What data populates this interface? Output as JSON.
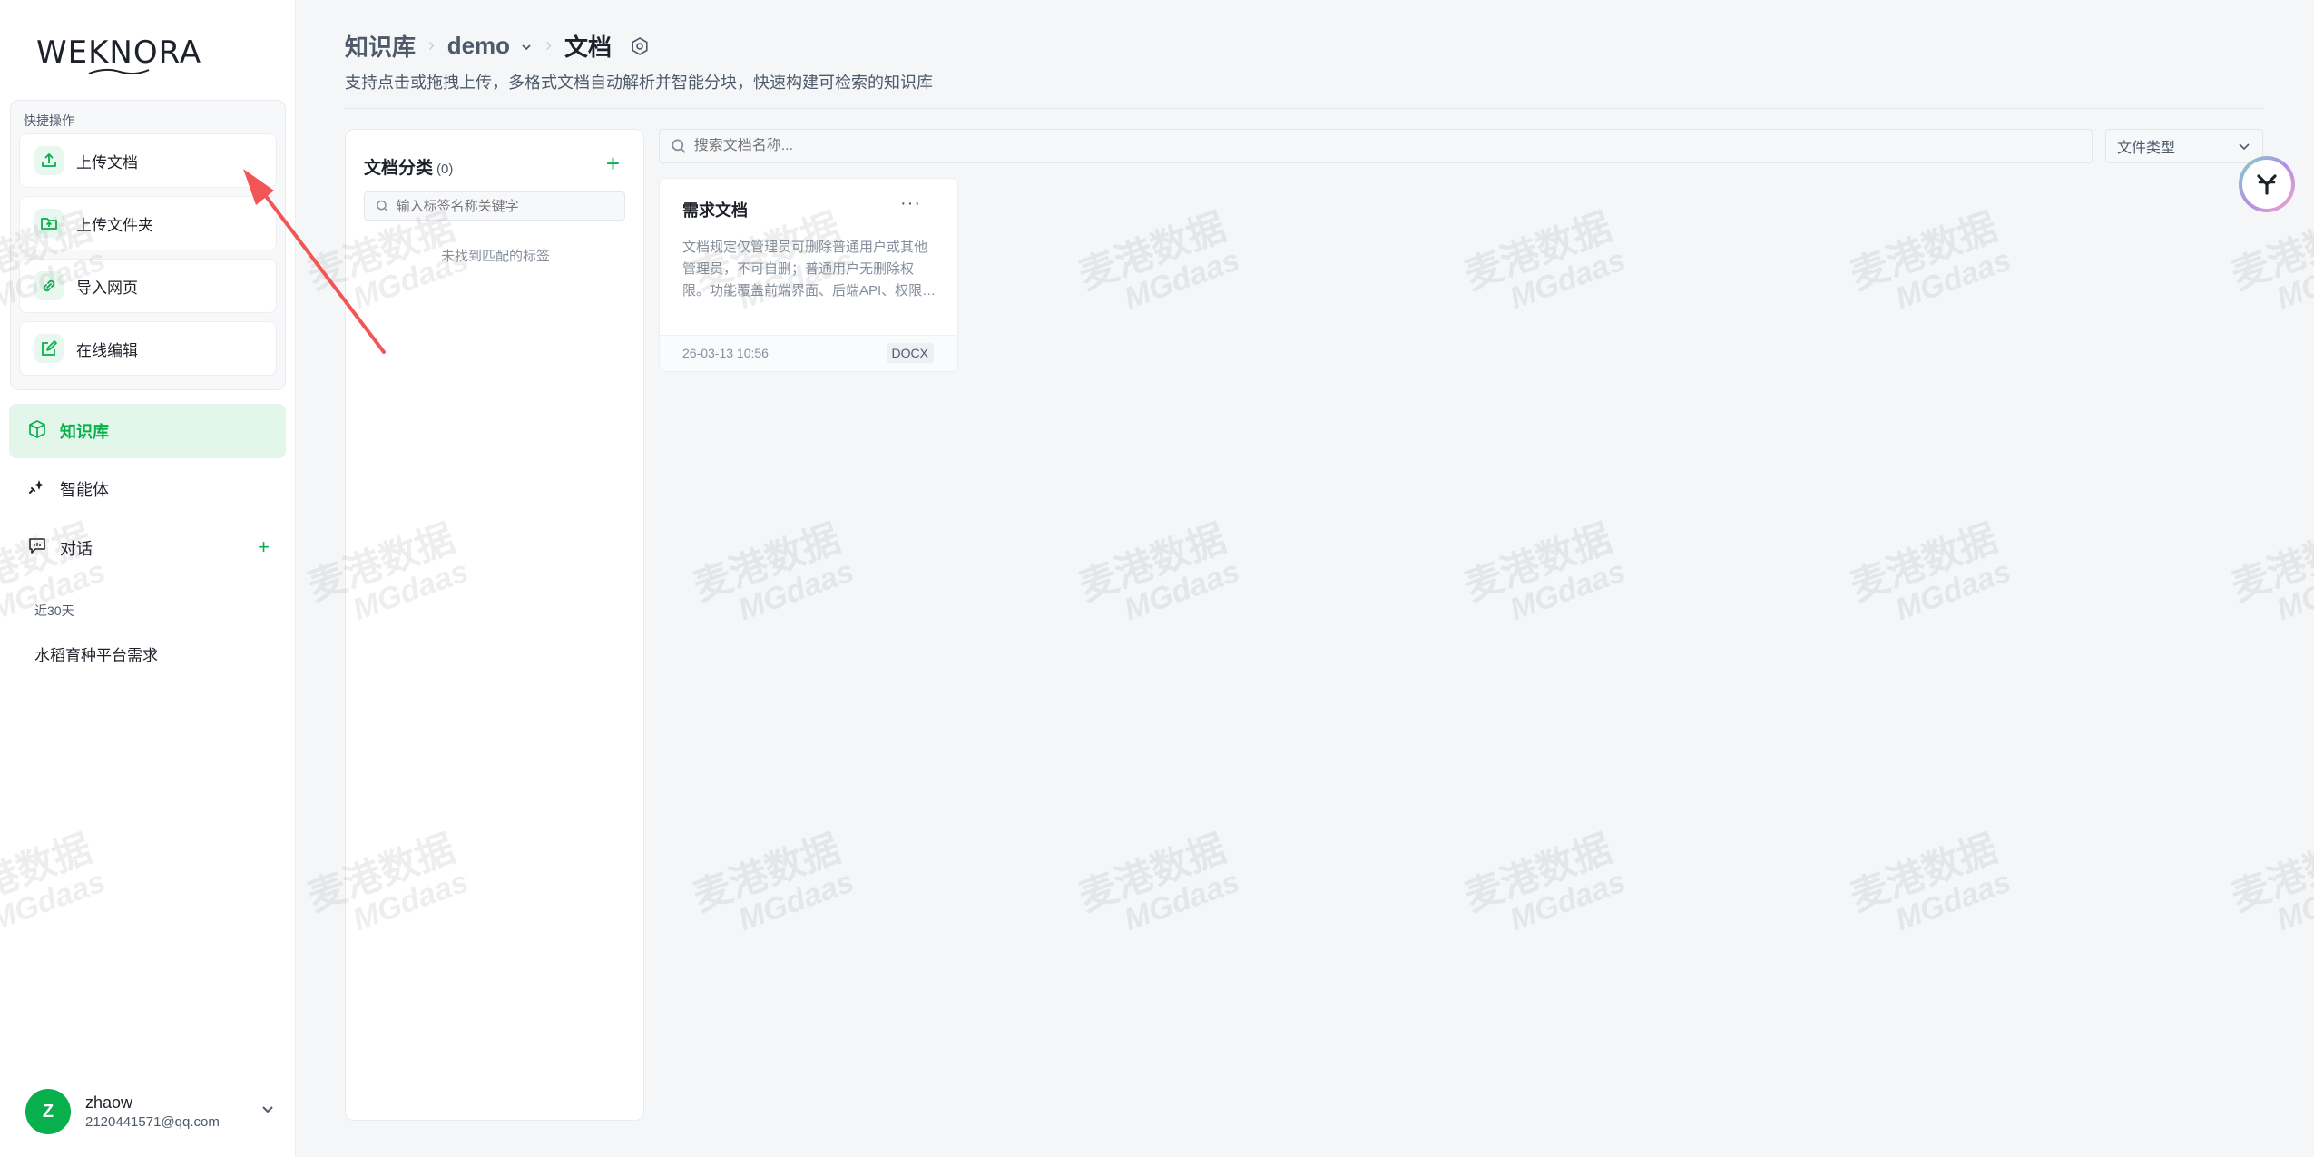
{
  "app": {
    "logo_text": "WEKNORA"
  },
  "sidebar": {
    "quick_actions_title": "快捷操作",
    "quick_actions": [
      {
        "label": "上传文档",
        "icon": "upload-icon"
      },
      {
        "label": "上传文件夹",
        "icon": "folder-upload-icon"
      },
      {
        "label": "导入网页",
        "icon": "link-icon"
      },
      {
        "label": "在线编辑",
        "icon": "edit-icon"
      }
    ],
    "nav": [
      {
        "label": "知识库",
        "icon": "cube-icon",
        "active": true
      },
      {
        "label": "智能体",
        "icon": "sparkle-icon",
        "active": false
      },
      {
        "label": "对话",
        "icon": "chat-icon",
        "active": false
      }
    ],
    "recent_title": "近30天",
    "recent_items": [
      "水稻育种平台需求"
    ],
    "user": {
      "initial": "Z",
      "name": "zhaow",
      "email": "2120441571@qq.com"
    }
  },
  "header": {
    "breadcrumb": [
      "知识库",
      "demo",
      "文档"
    ],
    "subtitle": "支持点击或拖拽上传，多格式文档自动解析并智能分块，快速构建可检索的知识库"
  },
  "categories": {
    "title": "文档分类",
    "count": "(0)",
    "search_placeholder": "输入标签名称关键字",
    "empty_text": "未找到匹配的标签"
  },
  "documents": {
    "search_placeholder": "搜索文档名称...",
    "type_filter_placeholder": "文件类型",
    "items": [
      {
        "title": "需求文档",
        "description": "文档规定仅管理员可删除普通用户或其他管理员，不可自删；普通用户无删除权限。功能覆盖前端界面、后端API、权限…",
        "time": "26-03-13 10:56",
        "type": "DOCX"
      }
    ]
  },
  "watermark": {
    "line1": "麦港数据",
    "line2": "MGdaas"
  },
  "colors": {
    "accent": "#07b04c",
    "active_bg": "#e3f6ea",
    "annotation_arrow": "#f25555"
  }
}
